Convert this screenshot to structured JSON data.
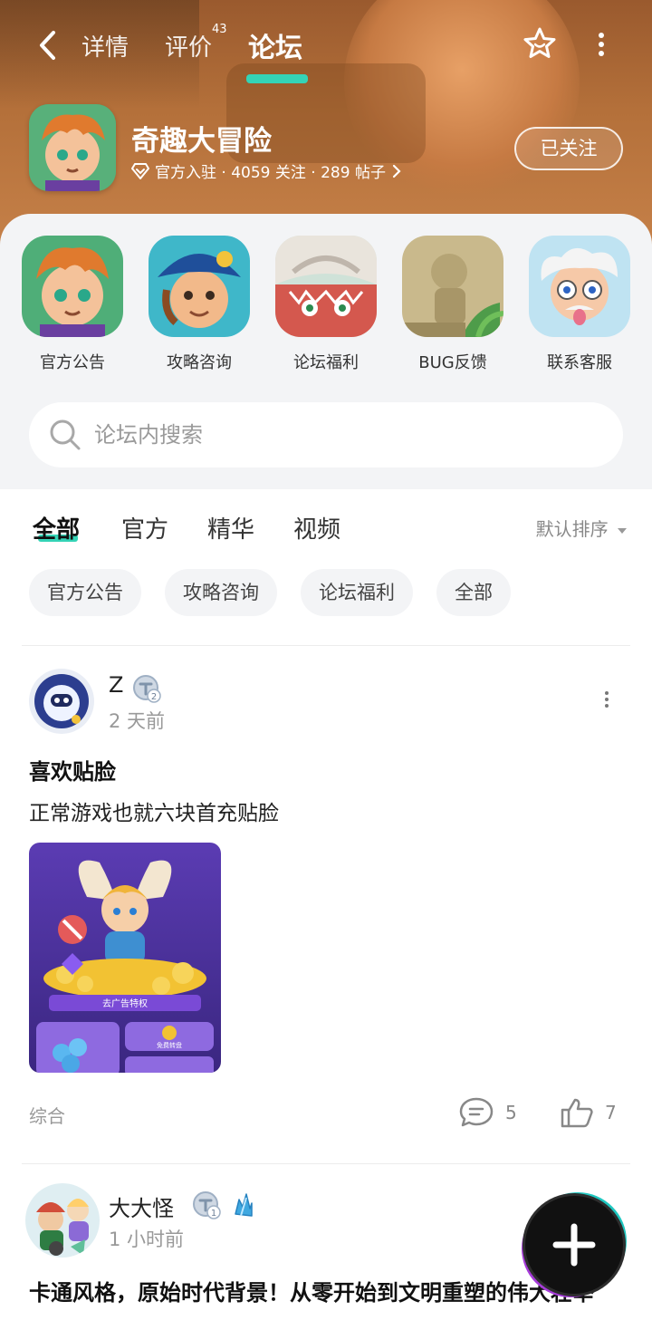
{
  "header": {
    "tabs": [
      {
        "label": "详情"
      },
      {
        "label": "评价",
        "badge": "43"
      },
      {
        "label": "论坛",
        "active": true
      }
    ]
  },
  "game": {
    "title": "奇趣大冒险",
    "meta": "官方入驻 · 4059 关注 · 289 帖子",
    "follow_label": "已关注"
  },
  "quick_links": [
    {
      "label": "官方公告",
      "icon": "hero-boy-icon"
    },
    {
      "label": "攻略咨询",
      "icon": "captain-icon"
    },
    {
      "label": "论坛福利",
      "icon": "monster-icon"
    },
    {
      "label": "BUG反馈",
      "icon": "statue-icon"
    },
    {
      "label": "联系客服",
      "icon": "professor-icon"
    }
  ],
  "search": {
    "placeholder": "论坛内搜索"
  },
  "filter_tabs": [
    {
      "label": "全部",
      "active": true
    },
    {
      "label": "官方"
    },
    {
      "label": "精华"
    },
    {
      "label": "视频"
    }
  ],
  "sort_label": "默认排序",
  "chips": [
    "官方公告",
    "攻略咨询",
    "论坛福利",
    "全部"
  ],
  "posts": [
    {
      "author": "Z",
      "level": "2",
      "time": "2 天前",
      "title": "喜欢贴脸",
      "body": "正常游戏也就六块首充贴脸",
      "image_caption": "去广告特权",
      "image_sub": "免费转盘",
      "category": "综合",
      "comments": "5",
      "likes": "7"
    },
    {
      "author": "大大怪",
      "level": "1",
      "time": "1 小时前",
      "title": "卡通风格，原始时代背景！从零开始到文明重塑的伟大壮举"
    }
  ],
  "colors": {
    "accent": "#34d3b6",
    "hero_bg": "#b4703a",
    "card_bg": "#f3f4f6"
  }
}
